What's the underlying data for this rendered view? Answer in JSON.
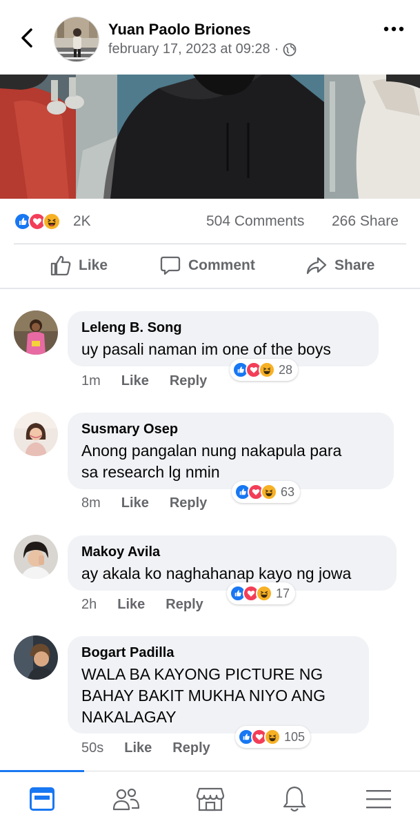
{
  "header": {
    "author": "Yuan Paolo Briones",
    "timestamp": "february 17, 2023 at 09:28",
    "separator": "·",
    "privacy_icon": "globe-icon",
    "back_icon": "chevron-left-icon",
    "more_icon": "more-horizontal-icon"
  },
  "post": {
    "reactions_count": "2K",
    "reaction_icons": [
      "like-icon",
      "love-icon",
      "haha-icon"
    ],
    "comments_count": "504 Comments",
    "shares_count": "266 Share"
  },
  "actions": {
    "like": "Like",
    "comment": "Comment",
    "share": "Share"
  },
  "comments": [
    {
      "name": "Leleng B. Song",
      "text": "uy pasali naman im one of the boys",
      "time": "1m",
      "like": "Like",
      "reply": "Reply",
      "reactions": "28"
    },
    {
      "name": "Susmary Osep",
      "text": "Anong pangalan nung nakapula para\nsa research lg nmin",
      "time": "8m",
      "like": "Like",
      "reply": "Reply",
      "reactions": "63"
    },
    {
      "name": "Makoy Avila",
      "text": "ay akala ko naghahanap kayo ng jowa",
      "time": "2h",
      "like": "Like",
      "reply": "Reply",
      "reactions": "17"
    },
    {
      "name": "Bogart Padilla",
      "text": "WALA BA KAYONG PICTURE NG\nBAHAY BAKIT MUKHA NIYO ANG\nNAKALAGAY",
      "time": "50s",
      "like": "Like",
      "reply": "Reply",
      "reactions": "105"
    }
  ],
  "bottom_nav": {
    "items": [
      "feed-icon",
      "friends-icon",
      "marketplace-icon",
      "notifications-icon",
      "menu-icon"
    ],
    "active": "feed-icon"
  },
  "colors": {
    "accent": "#1877f2",
    "like": "#1877f2",
    "love": "#f33e58",
    "haha": "#f7b125",
    "secondary_text": "#65676b",
    "bubble": "#f0f2f5"
  }
}
